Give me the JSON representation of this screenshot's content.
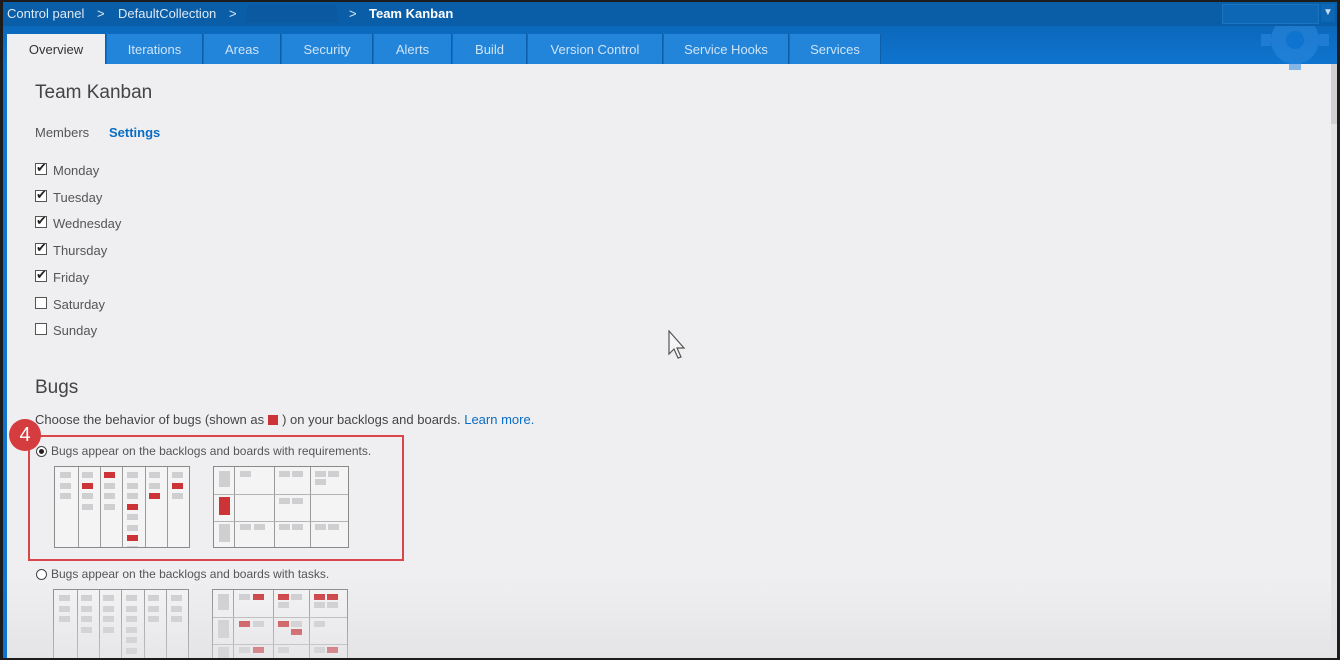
{
  "breadcrumb": {
    "control_panel": "Control panel",
    "collection": "DefaultCollection",
    "team": "Team Kanban",
    "sep": ">"
  },
  "tabs": [
    {
      "label": "Overview"
    },
    {
      "label": "Iterations"
    },
    {
      "label": "Areas"
    },
    {
      "label": "Security"
    },
    {
      "label": "Alerts"
    },
    {
      "label": "Build"
    },
    {
      "label": "Version Control"
    },
    {
      "label": "Service Hooks"
    },
    {
      "label": "Services"
    }
  ],
  "page": {
    "title": "Team Kanban",
    "subnav": {
      "members": "Members",
      "settings": "Settings"
    }
  },
  "working_days": [
    {
      "label": "Monday",
      "checked": true
    },
    {
      "label": "Tuesday",
      "checked": true
    },
    {
      "label": "Wednesday",
      "checked": true
    },
    {
      "label": "Thursday",
      "checked": true
    },
    {
      "label": "Friday",
      "checked": true
    },
    {
      "label": "Saturday",
      "checked": false
    },
    {
      "label": "Sunday",
      "checked": false
    }
  ],
  "bugs": {
    "heading": "Bugs",
    "desc_before": "Choose the behavior of bugs (shown as",
    "desc_after": ") on your backlogs and boards.",
    "learn_more": "Learn more.",
    "option_requirements": "Bugs appear on the backlogs and boards with requirements.",
    "option_tasks": "Bugs appear on the backlogs and boards with tasks.",
    "selected": "requirements"
  },
  "annotation": {
    "step": "4"
  },
  "colors": {
    "accent": "#0a6dc4",
    "topbar": "#0a5ea8",
    "bug_red": "#cc3438",
    "highlight": "#d9474b"
  },
  "icons": [
    "gear-icon",
    "mouse-pointer-icon",
    "dropdown-arrow-icon"
  ]
}
